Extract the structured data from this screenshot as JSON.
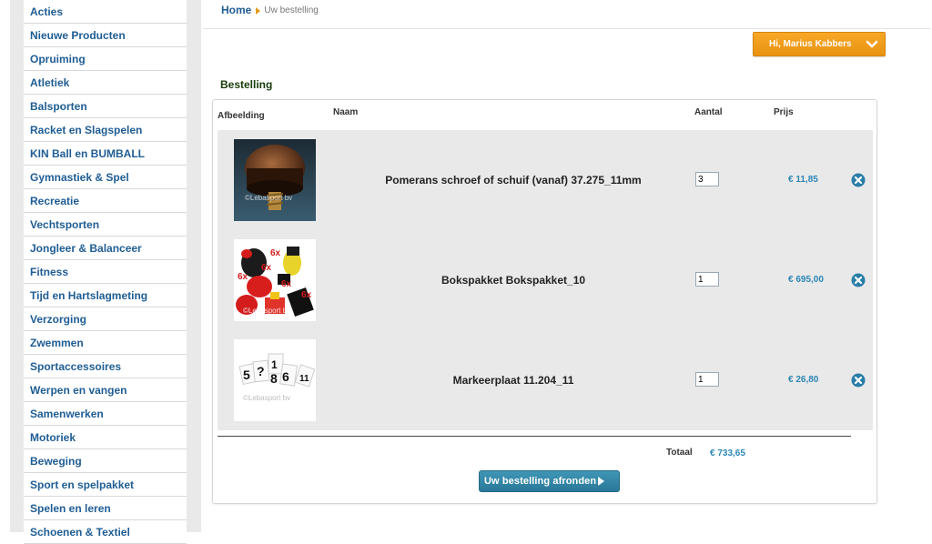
{
  "sidebar": {
    "items": [
      {
        "label": "Acties"
      },
      {
        "label": "Nieuwe Producten"
      },
      {
        "label": "Opruiming"
      },
      {
        "label": "Atletiek"
      },
      {
        "label": "Balsporten"
      },
      {
        "label": "Racket en Slagspelen"
      },
      {
        "label": "KIN Ball en BUMBALL"
      },
      {
        "label": "Gymnastiek & Spel"
      },
      {
        "label": "Recreatie"
      },
      {
        "label": "Vechtsporten"
      },
      {
        "label": "Jongleer & Balanceer"
      },
      {
        "label": "Fitness"
      },
      {
        "label": "Tijd en Hartslagmeting"
      },
      {
        "label": "Verzorging"
      },
      {
        "label": "Zwemmen"
      },
      {
        "label": "Sportaccessoires"
      },
      {
        "label": "Werpen en vangen"
      },
      {
        "label": "Samenwerken"
      },
      {
        "label": "Motoriek"
      },
      {
        "label": "Beweging"
      },
      {
        "label": "Sport en spelpakket"
      },
      {
        "label": "Spelen en leren"
      },
      {
        "label": "Schoenen & Textiel"
      }
    ]
  },
  "breadcrumb": {
    "home": "Home",
    "current": "Uw bestelling"
  },
  "user_menu": {
    "label": "Hi, Marius Kabbers",
    "icon": "chevron-down-icon"
  },
  "order": {
    "title": "Bestelling",
    "columns": {
      "image": "Afbeelding",
      "name": "Naam",
      "quantity": "Aantal",
      "price": "Prijs"
    },
    "items": [
      {
        "name": "Pomerans schroef of schuif (vanaf) 37.275_11mm",
        "quantity": "3",
        "price": "€ 11,85",
        "watermark": "©Lebasport bv"
      },
      {
        "name": "Bokspakket Bokspakket_10",
        "quantity": "1",
        "price": "€ 695,00",
        "watermark": "©Lebasport bv"
      },
      {
        "name": "Markeerplaat 11.204_11",
        "quantity": "1",
        "price": "€ 26,80",
        "watermark": "©Lebasport bv"
      }
    ],
    "total_label": "Totaal",
    "total_value": "€ 733,65",
    "checkout_label": "Uw bestelling afronden"
  },
  "colors": {
    "link": "#1f5d94",
    "accent": "#f7a826",
    "price": "#2b86b6",
    "button": "#2f86a8"
  }
}
